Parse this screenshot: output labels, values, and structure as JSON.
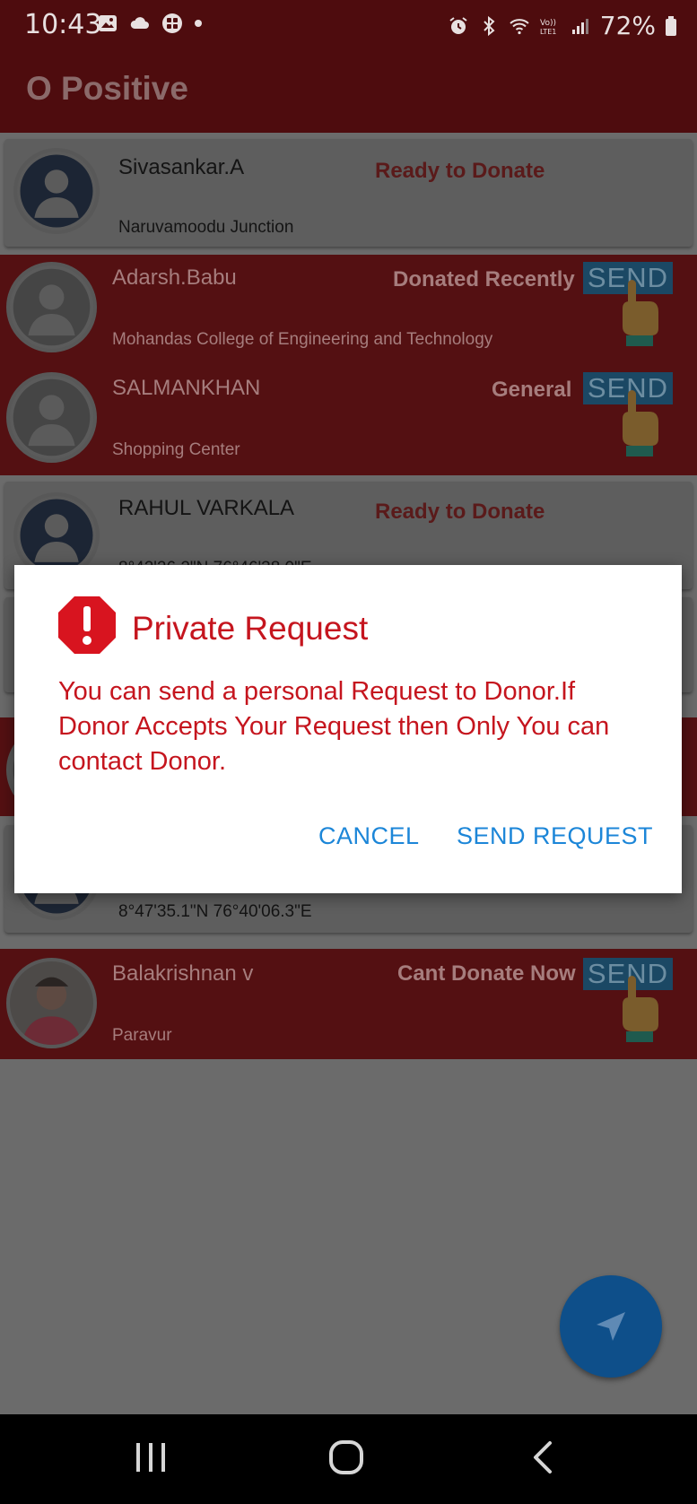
{
  "status_bar": {
    "time": "10:43",
    "battery": "72%",
    "left_icons": [
      "gallery-icon",
      "cloud-icon",
      "app-grid-icon",
      "dot-icon"
    ],
    "right_icons": [
      "alarm-icon",
      "bluetooth-icon",
      "wifi-icon",
      "volte-icon",
      "signal-icon",
      "battery-icon"
    ]
  },
  "app_bar": {
    "title": "O Positive"
  },
  "donors": [
    {
      "name": "Sivasankar.A",
      "status": "Ready to Donate",
      "location": "Naruvamoodu Junction",
      "style": "card",
      "send": ""
    },
    {
      "name": "Adarsh.Babu",
      "status": "Donated Recently",
      "location": "Mohandas College of Engineering and Technology",
      "style": "red",
      "send": "SEND"
    },
    {
      "name": "SALMANKHAN",
      "status": "General",
      "location": "Shopping Center",
      "style": "red",
      "send": "SEND"
    },
    {
      "name": "RAHUL VARKALA",
      "status": "Ready to Donate",
      "location": "8°42'26.2\"N 76°46'38.0\"E",
      "style": "card",
      "send": ""
    },
    {
      "name": "",
      "status": "",
      "location": "8°47'35.1\"N 76°40'06.3\"E",
      "style": "card",
      "send": ""
    },
    {
      "name": "Balakrishnan   v",
      "status": "Cant Donate Now",
      "location": "Paravur",
      "style": "red",
      "send": "SEND"
    }
  ],
  "dialog": {
    "title": "Private Request",
    "message": "You can send a personal Request to Donor.If Donor Accepts  Your Request then Only You can contact Donor.",
    "cancel_label": "CANCEL",
    "confirm_label": "SEND REQUEST",
    "icon": "error-octagon-icon"
  },
  "fab": {
    "icon": "navigation-arrow-icon"
  },
  "nav_bar": {
    "icons": [
      "recents-icon",
      "home-icon",
      "back-icon"
    ]
  },
  "colors": {
    "accent_red": "#c5151e",
    "dialog_button": "#1c86d8",
    "fab_blue": "#0e4f8a",
    "appbar": "#4e0c0e"
  }
}
